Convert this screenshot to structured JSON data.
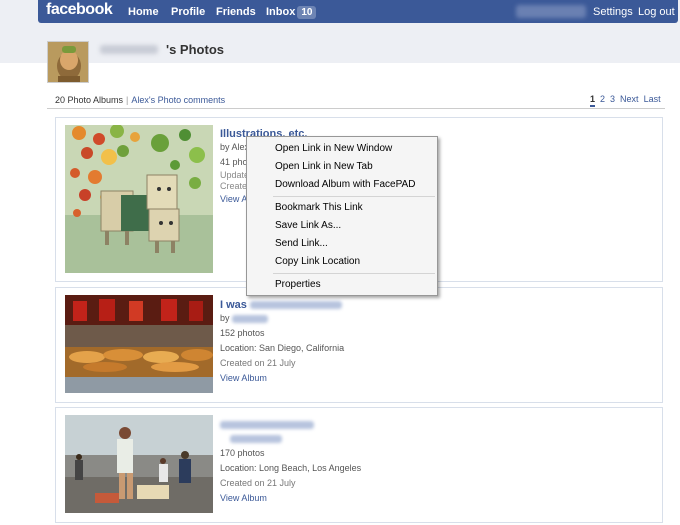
{
  "topbar": {
    "logo": "facebook",
    "nav": {
      "home": "Home",
      "profile": "Profile",
      "friends": "Friends",
      "inbox": "Inbox",
      "inbox_count": "10"
    },
    "settings": "Settings",
    "logout": "Log out"
  },
  "header": {
    "title": "'s Photos"
  },
  "subheader": {
    "albums_count": "20 Photo Albums",
    "separator": "|",
    "comments_link": "Alex's Photo comments",
    "pager": {
      "p1": "1",
      "p2": "2",
      "p3": "3",
      "next": "Next",
      "last": "Last"
    }
  },
  "albums": [
    {
      "title": "Illustrations, etc.",
      "by": "by Alex",
      "count": "41 pho",
      "updated": "Update",
      "created": "Create",
      "view": "View A"
    },
    {
      "title": "I was",
      "by": "by",
      "count": "152 photos",
      "location": "Location: San Diego, California",
      "created": "Created on 21 July",
      "view": "View Album"
    },
    {
      "title": "",
      "by": "",
      "count": "170 photos",
      "location": "Location: Long Beach, Los Angeles",
      "created": "Created on 21 July",
      "view": "View Album"
    }
  ],
  "context_menu": {
    "open_new_window": "Open Link in New Window",
    "open_new_tab": "Open Link in New Tab",
    "download_album": "Download Album with FacePAD",
    "bookmark": "Bookmark This Link",
    "save_link": "Save Link As...",
    "send_link": "Send Link...",
    "copy_location": "Copy Link Location",
    "properties": "Properties"
  },
  "colors": {
    "brand": "#3b5998",
    "link": "#3b5998",
    "page_bg": "#edeff4"
  }
}
